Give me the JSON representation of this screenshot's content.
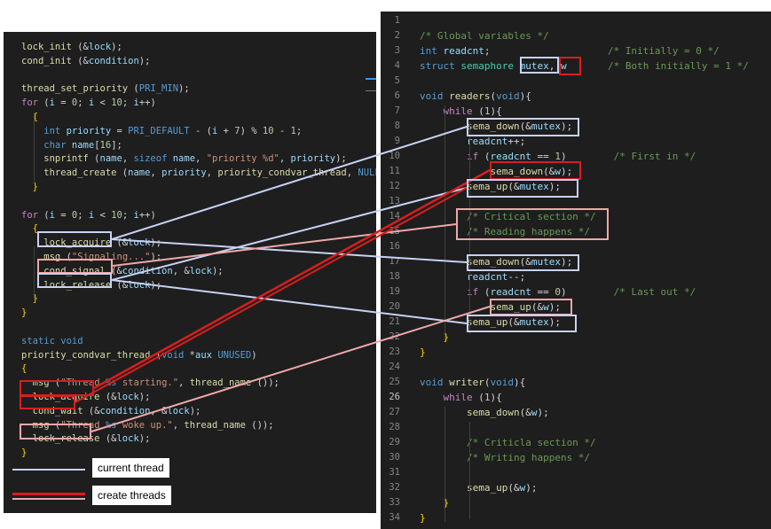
{
  "left_code": {
    "lines": [
      [
        [
          "lock_init",
          "fn"
        ],
        [
          " (&",
          "p"
        ],
        [
          "lock",
          "v"
        ],
        [
          ");",
          "p"
        ]
      ],
      [
        [
          "cond_init",
          "fn"
        ],
        [
          " (&",
          "p"
        ],
        [
          "condition",
          "v"
        ],
        [
          ");",
          "p"
        ]
      ],
      [],
      [
        [
          "thread_set_priority",
          "fn"
        ],
        [
          " (",
          "p"
        ],
        [
          "PRI_MIN",
          "kb"
        ],
        [
          ");",
          "p"
        ]
      ],
      [
        [
          "for",
          "k"
        ],
        [
          " (",
          "p"
        ],
        [
          "i",
          "v"
        ],
        [
          " = ",
          "p"
        ],
        [
          "0",
          "n"
        ],
        [
          "; ",
          "p"
        ],
        [
          "i",
          "v"
        ],
        [
          " < ",
          "p"
        ],
        [
          "10",
          "n"
        ],
        [
          "; ",
          "p"
        ],
        [
          "i",
          "v"
        ],
        [
          "++)",
          "p"
        ]
      ],
      [
        [
          "  {",
          "ic"
        ]
      ],
      [
        [
          "    int",
          "kb"
        ],
        [
          " ",
          "p"
        ],
        [
          "priority",
          "v"
        ],
        [
          " = ",
          "p"
        ],
        [
          "PRI_DEFAULT",
          "kb"
        ],
        [
          " - (",
          "p"
        ],
        [
          "i",
          "v"
        ],
        [
          " + ",
          "p"
        ],
        [
          "7",
          "n"
        ],
        [
          ") % ",
          "p"
        ],
        [
          "10",
          "n"
        ],
        [
          " - ",
          "p"
        ],
        [
          "1",
          "n"
        ],
        [
          ";",
          "p"
        ]
      ],
      [
        [
          "    char",
          "kb"
        ],
        [
          " ",
          "p"
        ],
        [
          "name",
          "v"
        ],
        [
          "[",
          "p"
        ],
        [
          "16",
          "n"
        ],
        [
          "];",
          "p"
        ]
      ],
      [
        [
          "    snprintf",
          "fn"
        ],
        [
          " (",
          "p"
        ],
        [
          "name",
          "v"
        ],
        [
          ", ",
          "p"
        ],
        [
          "sizeof",
          "kb"
        ],
        [
          " ",
          "p"
        ],
        [
          "name",
          "v"
        ],
        [
          ", ",
          "p"
        ],
        [
          "\"priority %d\"",
          "s"
        ],
        [
          ", ",
          "p"
        ],
        [
          "priority",
          "v"
        ],
        [
          ");",
          "p"
        ]
      ],
      [
        [
          "    thread_create",
          "fn"
        ],
        [
          " (",
          "p"
        ],
        [
          "name",
          "v"
        ],
        [
          ", ",
          "p"
        ],
        [
          "priority",
          "v"
        ],
        [
          ", ",
          "p"
        ],
        [
          "priority_condvar_thread",
          "fn"
        ],
        [
          ", ",
          "p"
        ],
        [
          "NULL",
          "kb"
        ]
      ],
      [
        [
          "  }",
          "ic"
        ]
      ],
      [],
      [
        [
          "for",
          "k"
        ],
        [
          " (",
          "p"
        ],
        [
          "i",
          "v"
        ],
        [
          " = ",
          "p"
        ],
        [
          "0",
          "n"
        ],
        [
          "; ",
          "p"
        ],
        [
          "i",
          "v"
        ],
        [
          " < ",
          "p"
        ],
        [
          "10",
          "n"
        ],
        [
          "; ",
          "p"
        ],
        [
          "i",
          "v"
        ],
        [
          "++)",
          "p"
        ]
      ],
      [
        [
          "  {",
          "ic"
        ]
      ],
      [
        [
          "    lock_acquire",
          "fn"
        ],
        [
          " (&",
          "p"
        ],
        [
          "lock",
          "v"
        ],
        [
          ");",
          "p"
        ]
      ],
      [
        [
          "    msg",
          "fn"
        ],
        [
          " (",
          "p"
        ],
        [
          "\"Signaling...\"",
          "s"
        ],
        [
          ");",
          "p"
        ]
      ],
      [
        [
          "    cond_signal",
          "fn"
        ],
        [
          " (&",
          "p"
        ],
        [
          "condition",
          "v"
        ],
        [
          ", &",
          "p"
        ],
        [
          "lock",
          "v"
        ],
        [
          ");",
          "p"
        ]
      ],
      [
        [
          "    lock_release",
          "fn"
        ],
        [
          " (&",
          "p"
        ],
        [
          "lock",
          "v"
        ],
        [
          ");",
          "p"
        ]
      ],
      [
        [
          "  }",
          "ic"
        ]
      ],
      [
        [
          "}",
          "ic"
        ]
      ],
      [],
      [
        [
          "static",
          "kb"
        ],
        [
          " ",
          "p"
        ],
        [
          "void",
          "kb"
        ]
      ],
      [
        [
          "priority_condvar_thread",
          "fn"
        ],
        [
          " (",
          "p"
        ],
        [
          "void",
          "kb"
        ],
        [
          " *",
          "p"
        ],
        [
          "aux",
          "v"
        ],
        [
          " ",
          "p"
        ],
        [
          "UNUSED",
          "kb"
        ],
        [
          ")",
          "p"
        ]
      ],
      [
        [
          "{",
          "ic"
        ]
      ],
      [
        [
          "  msg",
          "fn"
        ],
        [
          " (",
          "p"
        ],
        [
          "\"Thread ",
          "s"
        ],
        [
          "%s",
          "kb"
        ],
        [
          " starting.\"",
          "s"
        ],
        [
          ", ",
          "p"
        ],
        [
          "thread_name",
          "fn"
        ],
        [
          " ());",
          "p"
        ]
      ],
      [
        [
          "  lock_acquire",
          "fn"
        ],
        [
          " (&",
          "p"
        ],
        [
          "lock",
          "v"
        ],
        [
          ");",
          "p"
        ]
      ],
      [
        [
          "  cond_wait",
          "fn"
        ],
        [
          " (&",
          "p"
        ],
        [
          "condition",
          "v"
        ],
        [
          ", &",
          "p"
        ],
        [
          "lock",
          "v"
        ],
        [
          ");",
          "p"
        ]
      ],
      [
        [
          "  msg",
          "fn"
        ],
        [
          " (",
          "p"
        ],
        [
          "\"Thread ",
          "s"
        ],
        [
          "%s",
          "kb"
        ],
        [
          " woke up.\"",
          "s"
        ],
        [
          ", ",
          "p"
        ],
        [
          "thread_name",
          "fn"
        ],
        [
          " ());",
          "p"
        ]
      ],
      [
        [
          "  lock_release",
          "fn"
        ],
        [
          " (&",
          "p"
        ],
        [
          "lock",
          "v"
        ],
        [
          ");",
          "p"
        ]
      ],
      [
        [
          "}",
          "ic"
        ]
      ]
    ]
  },
  "right_code": {
    "line_numbers": [
      "1",
      "2",
      "3",
      "4",
      "5",
      "6",
      "7",
      "8",
      "9",
      "10",
      "11",
      "12",
      "13",
      "14",
      "15",
      "16",
      "17",
      "18",
      "19",
      "20",
      "21",
      "22",
      "23",
      "24",
      "25",
      "26",
      "27",
      "28",
      "29",
      "30",
      "31",
      "32",
      "33",
      "34"
    ],
    "lines": [
      [],
      [
        [
          "/* Global variables */",
          "c"
        ]
      ],
      [
        [
          "int",
          "kb"
        ],
        [
          " ",
          "p"
        ],
        [
          "readcnt",
          "v"
        ],
        [
          ";                    ",
          "p"
        ],
        [
          "/* Initially = 0 */",
          "c"
        ]
      ],
      [
        [
          "struct",
          "kb"
        ],
        [
          " ",
          "p"
        ],
        [
          "semaphore",
          "t"
        ],
        [
          " ",
          "p"
        ],
        [
          "mutex",
          "v"
        ],
        [
          ", ",
          "p"
        ],
        [
          "w",
          "v"
        ],
        [
          "       ",
          "p"
        ],
        [
          "/* Both initially = 1 */",
          "c"
        ]
      ],
      [],
      [
        [
          "void",
          "kb"
        ],
        [
          " ",
          "p"
        ],
        [
          "readers",
          "fn"
        ],
        [
          "(",
          "p"
        ],
        [
          "void",
          "kb"
        ],
        [
          "){",
          "p"
        ]
      ],
      [
        [
          "    while",
          "k"
        ],
        [
          " (",
          "p"
        ],
        [
          "1",
          "n"
        ],
        [
          "){",
          "p"
        ]
      ],
      [
        [
          "        sema_down",
          "fn"
        ],
        [
          "(&",
          "p"
        ],
        [
          "mutex",
          "v"
        ],
        [
          ");",
          "p"
        ]
      ],
      [
        [
          "        readcnt",
          "v"
        ],
        [
          "++;",
          "p"
        ]
      ],
      [
        [
          "        if",
          "k"
        ],
        [
          " (",
          "p"
        ],
        [
          "readcnt",
          "v"
        ],
        [
          " == ",
          "p"
        ],
        [
          "1",
          "n"
        ],
        [
          ")        ",
          "p"
        ],
        [
          "/* First in */",
          "c"
        ]
      ],
      [
        [
          "            sema_down",
          "fn"
        ],
        [
          "(&",
          "p"
        ],
        [
          "w",
          "v"
        ],
        [
          ");",
          "p"
        ]
      ],
      [
        [
          "        sema_up",
          "fn"
        ],
        [
          "(&",
          "p"
        ],
        [
          "mutex",
          "v"
        ],
        [
          ");",
          "p"
        ]
      ],
      [],
      [
        [
          "        /* Critical section */",
          "c"
        ]
      ],
      [
        [
          "        /* Reading happens */",
          "c"
        ]
      ],
      [],
      [
        [
          "        sema_down",
          "fn"
        ],
        [
          "(&",
          "p"
        ],
        [
          "mutex",
          "v"
        ],
        [
          ");",
          "p"
        ]
      ],
      [
        [
          "        readcnt",
          "v"
        ],
        [
          "--;",
          "p"
        ]
      ],
      [
        [
          "        if",
          "k"
        ],
        [
          " (",
          "p"
        ],
        [
          "readcnt",
          "v"
        ],
        [
          " == ",
          "p"
        ],
        [
          "0",
          "n"
        ],
        [
          ")        ",
          "p"
        ],
        [
          "/* Last out */",
          "c"
        ]
      ],
      [
        [
          "            sema_up",
          "fn"
        ],
        [
          "(&",
          "p"
        ],
        [
          "w",
          "v"
        ],
        [
          ");",
          "p"
        ]
      ],
      [
        [
          "        sema_up",
          "fn"
        ],
        [
          "(&",
          "p"
        ],
        [
          "mutex",
          "v"
        ],
        [
          ");",
          "p"
        ]
      ],
      [
        [
          "    }",
          "ic"
        ]
      ],
      [
        [
          "}",
          "ic"
        ]
      ],
      [],
      [
        [
          "void",
          "kb"
        ],
        [
          " ",
          "p"
        ],
        [
          "writer",
          "fn"
        ],
        [
          "(",
          "p"
        ],
        [
          "void",
          "kb"
        ],
        [
          "){",
          "p"
        ]
      ],
      [
        [
          "    while",
          "k"
        ],
        [
          " (",
          "p"
        ],
        [
          "1",
          "n"
        ],
        [
          "){",
          "p"
        ]
      ],
      [
        [
          "        sema_down",
          "fn"
        ],
        [
          "(&",
          "p"
        ],
        [
          "w",
          "v"
        ],
        [
          ");",
          "p"
        ]
      ],
      [],
      [
        [
          "        /* Criticla section */",
          "c"
        ]
      ],
      [
        [
          "        /* Writing happens */",
          "c"
        ]
      ],
      [],
      [
        [
          "        sema_up",
          "fn"
        ],
        [
          "(&",
          "p"
        ],
        [
          "w",
          "v"
        ],
        [
          ");",
          "p"
        ]
      ],
      [
        [
          "    }",
          "ic"
        ]
      ],
      [
        [
          "}",
          "ic"
        ]
      ]
    ]
  },
  "legend": {
    "current_thread": "current thread",
    "create_threads": "create threads"
  },
  "colors": {
    "current_thread": "#c7d2f5",
    "create_threads": "#d81e1e",
    "link_pink": "#f0a8a8",
    "editor_bg": "#1e1e1e"
  }
}
